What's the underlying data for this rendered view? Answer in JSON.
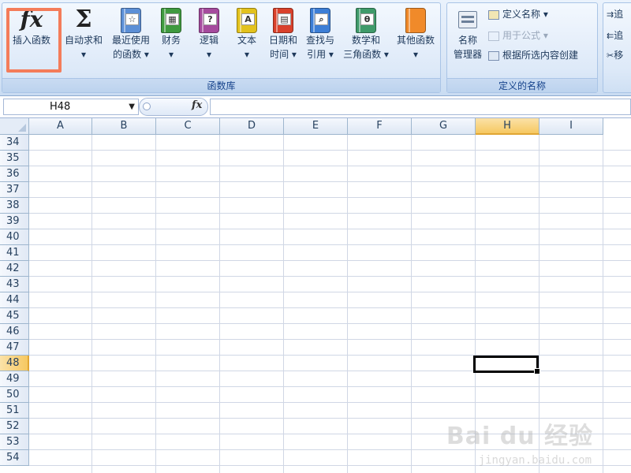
{
  "ribbon": {
    "function_library": {
      "label": "函数库",
      "buttons": [
        {
          "label1": "插入函数",
          "label2": ""
        },
        {
          "label1": "自动求和",
          "label2": "▾"
        },
        {
          "label1": "最近使用",
          "label2": "的函数 ▾",
          "icon_text": "☆",
          "color": "#5c8fd6"
        },
        {
          "label1": "财务",
          "label2": "▾",
          "icon_text": "▦",
          "color": "#3f9a3f"
        },
        {
          "label1": "逻辑",
          "label2": "▾",
          "icon_text": "?",
          "color": "#a54a9d"
        },
        {
          "label1": "文本",
          "label2": "▾",
          "icon_text": "A",
          "color": "#e3c21d"
        },
        {
          "label1": "日期和",
          "label2": "时间 ▾",
          "icon_text": "▤",
          "color": "#d9412b"
        },
        {
          "label1": "查找与",
          "label2": "引用 ▾",
          "icon_text": "⌕",
          "color": "#3c7ed6"
        },
        {
          "label1": "数学和",
          "label2": "三角函数 ▾",
          "icon_text": "θ",
          "color": "#3f9a6a"
        },
        {
          "label1": "其他函数",
          "label2": "▾",
          "icon_text": "",
          "color": "#f08a2a"
        }
      ]
    },
    "defined_names": {
      "label": "定义的名称",
      "manager_label1": "名称",
      "manager_label2": "管理器",
      "define_name": "定义名称 ▾",
      "use_in_formula": "用于公式 ▾",
      "create_from_selection": "根据所选内容创建"
    },
    "auditing": {
      "item1": "追",
      "item2": "追",
      "item3": "移"
    }
  },
  "formula_bar": {
    "name_box": "H48",
    "fx": "fx",
    "content": ""
  },
  "grid": {
    "columns": [
      "A",
      "B",
      "C",
      "D",
      "E",
      "F",
      "G",
      "H",
      "I"
    ],
    "rows": [
      "34",
      "35",
      "36",
      "37",
      "38",
      "39",
      "40",
      "41",
      "42",
      "43",
      "44",
      "45",
      "46",
      "47",
      "48",
      "49",
      "50",
      "51",
      "52",
      "53",
      "54"
    ],
    "selected_column": "H",
    "selected_row": "48"
  },
  "watermark": {
    "main": "Bai du 经验",
    "sub": "jingyan.baidu.com"
  }
}
